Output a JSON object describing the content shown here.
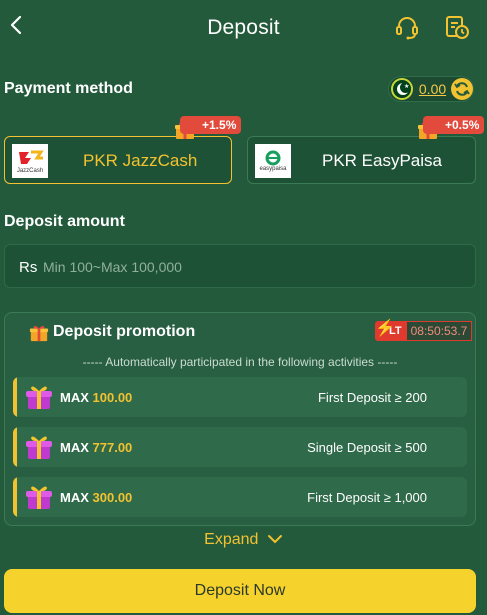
{
  "header": {
    "title": "Deposit",
    "back_icon": "chevron-left-icon",
    "support_icon": "headset-icon",
    "history_icon": "history-clock-icon"
  },
  "payment": {
    "title": "Payment method",
    "balance": "0.00",
    "currency_flag": "pakistan-flag-icon",
    "methods": [
      {
        "name": "PKR JazzCash",
        "bonus": "+1.5%",
        "logo_text": "JazzCash",
        "selected": true
      },
      {
        "name": "PKR EasyPaisa",
        "bonus": "+0.5%",
        "logo_text": "easypaisa",
        "selected": false
      }
    ]
  },
  "amount": {
    "title": "Deposit amount",
    "currency_symbol": "Rs",
    "placeholder": "Min 100~Max 100,000",
    "value": ""
  },
  "promotion": {
    "title": "Deposit promotion",
    "timer_badge": "LT",
    "timer": "08:50:53.7",
    "note": "----- Automatically participated in the following activities -----",
    "items": [
      {
        "max_label": "MAX",
        "max_value": "100.00",
        "condition": "First Deposit ≥ 200"
      },
      {
        "max_label": "MAX",
        "max_value": "777.00",
        "condition": "Single Deposit ≥ 500"
      },
      {
        "max_label": "MAX",
        "max_value": "300.00",
        "condition": "First Deposit ≥ 1,000"
      }
    ]
  },
  "expand_label": "Expand",
  "submit_label": "Deposit Now",
  "colors": {
    "background": "#235a3c",
    "accent": "#f3c230",
    "badge_red": "#e24a3c",
    "button": "#f6d22d"
  }
}
